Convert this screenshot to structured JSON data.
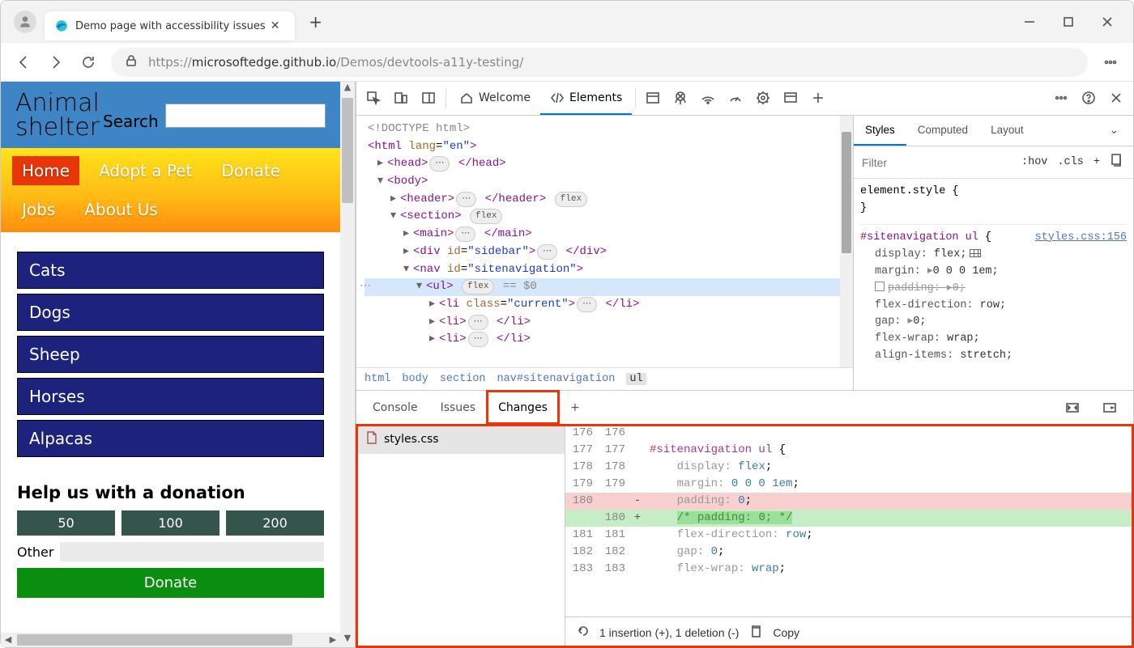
{
  "browser": {
    "tab_title": "Demo page with accessibility issues",
    "url_prefix": "https://",
    "url_host": "microsoftedge.github.io",
    "url_path": "/Demos/devtools-a11y-testing/"
  },
  "page": {
    "hero_line1": "Animal",
    "hero_line2": "shelter",
    "search_label": "Search",
    "nav": [
      "Home",
      "Adopt a Pet",
      "Donate",
      "Jobs",
      "About Us"
    ],
    "categories": [
      "Cats",
      "Dogs",
      "Sheep",
      "Horses",
      "Alpacas"
    ],
    "donation_heading": "Help us with a donation",
    "amounts": [
      "50",
      "100",
      "200"
    ],
    "other_label": "Other",
    "donate_btn": "Donate"
  },
  "devtools": {
    "tabs": {
      "welcome": "Welcome",
      "elements": "Elements"
    },
    "dom": {
      "doctype": "<!DOCTYPE html>",
      "html_open": "<html lang=\"en\">",
      "head": "<head>",
      "head_close": "</head>",
      "body": "<body>",
      "header": "<header>",
      "header_close": "</header>",
      "header_pill": "flex",
      "section": "<section>",
      "section_pill": "flex",
      "main": "<main>",
      "main_close": "</main>",
      "sidebar_open": "<div id=\"sidebar\">",
      "sidebar_close": "</div>",
      "nav_open": "<nav id=\"sitenavigation\">",
      "ul": "<ul>",
      "ul_pill": "flex",
      "ul_note": "== $0",
      "li_cur_open": "<li class=\"current\">",
      "li_close": "</li>",
      "li": "<li>"
    },
    "breadcrumb": [
      "html",
      "body",
      "section",
      "nav#sitenavigation",
      "ul"
    ],
    "styles": {
      "tabs": [
        "Styles",
        "Computed",
        "Layout"
      ],
      "filter_placeholder": "Filter",
      "hov": ":hov",
      "cls": ".cls",
      "element_style": "element.style {",
      "close_brace": "}",
      "rule_selector": "#sitenavigation ul",
      "rule_src": "styles.css:156",
      "props": {
        "display": "display:",
        "display_v": "flex;",
        "margin": "margin:",
        "margin_v": "0 0 0 1em;",
        "padding": "padding:",
        "padding_v": "0;",
        "flexdir": "flex-direction:",
        "flexdir_v": "row;",
        "gap": "gap:",
        "gap_v": "0;",
        "wrap": "flex-wrap:",
        "wrap_v": "wrap;",
        "align": "align-items:",
        "align_v": "stretch;"
      }
    },
    "drawer": {
      "tabs": [
        "Console",
        "Issues",
        "Changes"
      ],
      "file": "styles.css",
      "lines": {
        "sel": "#sitenavigation ul {",
        "display": "    display: flex;",
        "margin": "    margin: 0 0 0 1em;",
        "pad_del": "    padding: 0;",
        "pad_add": "    /* padding: 0; */",
        "flexdir": "    flex-direction: row;",
        "gap": "    gap: 0;",
        "wrap": "    flex-wrap: wrap;"
      },
      "ln": {
        "l176": "176",
        "l177": "177",
        "l178": "178",
        "l179": "179",
        "l180": "180",
        "l181": "181",
        "l182": "182",
        "l183": "183"
      },
      "status": "1 insertion (+), 1 deletion (-)",
      "copy": "Copy"
    }
  }
}
